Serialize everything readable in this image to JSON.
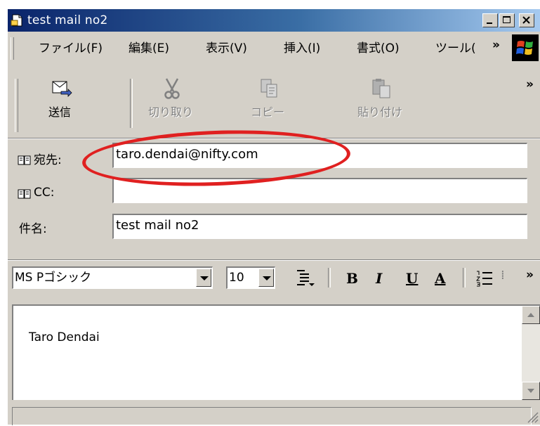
{
  "window": {
    "title": "test mail no2",
    "controls": {
      "minimize": "_",
      "maximize": "□",
      "close": "✕"
    }
  },
  "menubar": {
    "items": [
      {
        "label": "ファイル(F)"
      },
      {
        "label": "編集(E)"
      },
      {
        "label": "表示(V)"
      },
      {
        "label": "挿入(I)"
      },
      {
        "label": "書式(O)"
      },
      {
        "label": "ツール("
      }
    ],
    "overflow": "»"
  },
  "toolbar": {
    "send": "送信",
    "cut": "切り取り",
    "copy": "コピー",
    "paste": "貼り付け",
    "overflow": "»"
  },
  "header": {
    "to_label": "宛先:",
    "to_value": "taro.dendai@nifty.com",
    "cc_label": "CC:",
    "cc_value": "",
    "subject_label": "件名:",
    "subject_value": "test mail no2"
  },
  "format": {
    "font": "MS Pゴシック",
    "size": "10",
    "bold": "B",
    "italic": "I",
    "underline": "U",
    "font_color": "A",
    "overflow": "»"
  },
  "body": {
    "text": "Taro Dendai"
  },
  "colors": {
    "highlight_oval": "#e02020",
    "face": "#d4d0c8",
    "title_gradient_start": "#0a246a"
  }
}
